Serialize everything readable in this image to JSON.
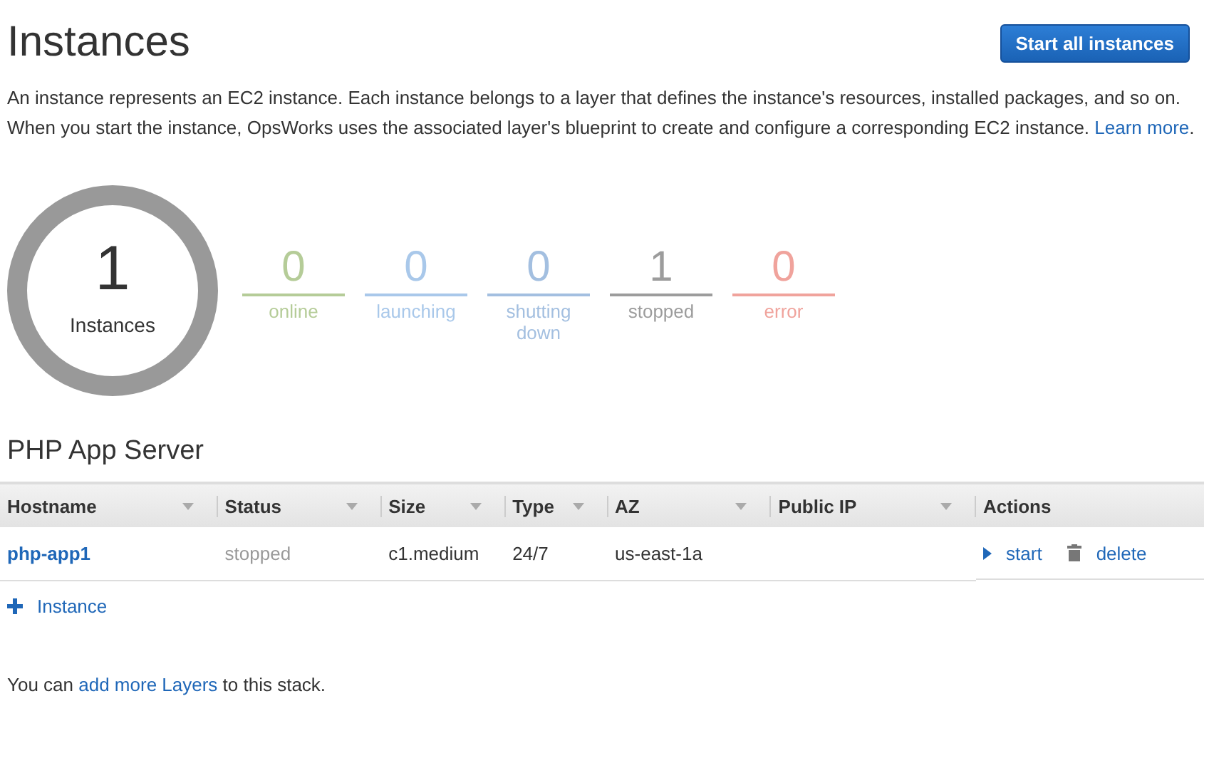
{
  "title": "Instances",
  "start_button": "Start all instances",
  "intro": {
    "text": "An instance represents an EC2 instance. Each instance belongs to a layer that defines the instance's resources, installed packages, and so on. When you start the instance, OpsWorks uses the associated layer's blueprint to create and configure a corresponding EC2 instance.",
    "link": "Learn more",
    "after": "."
  },
  "total": {
    "count": "1",
    "label": "Instances"
  },
  "stats": [
    {
      "count": "0",
      "label": "online",
      "color": "#b5cc98"
    },
    {
      "count": "0",
      "label": "launching",
      "color": "#a9c8ea"
    },
    {
      "count": "0",
      "label": "shutting down",
      "color": "#a3bfe0"
    },
    {
      "count": "1",
      "label": "stopped",
      "color": "#9c9c9c"
    },
    {
      "count": "0",
      "label": "error",
      "color": "#f0a39c"
    }
  ],
  "layer": {
    "title": "PHP App Server",
    "columns": [
      {
        "label": "Hostname",
        "sortable": true
      },
      {
        "label": "Status",
        "sortable": true
      },
      {
        "label": "Size",
        "sortable": true
      },
      {
        "label": "Type",
        "sortable": true
      },
      {
        "label": "AZ",
        "sortable": true
      },
      {
        "label": "Public IP",
        "sortable": true
      },
      {
        "label": "Actions",
        "sortable": false
      }
    ],
    "rows": [
      {
        "hostname": "php-app1",
        "status": "stopped",
        "size": "c1.medium",
        "type": "24/7",
        "az": "us-east-1a",
        "actions": [
          {
            "kind": "start",
            "label": "start"
          },
          {
            "kind": "delete",
            "label": "delete"
          }
        ]
      }
    ],
    "add": "Instance"
  },
  "footer": {
    "before": "You can",
    "link": "add more Layers",
    "after": "to this stack."
  }
}
